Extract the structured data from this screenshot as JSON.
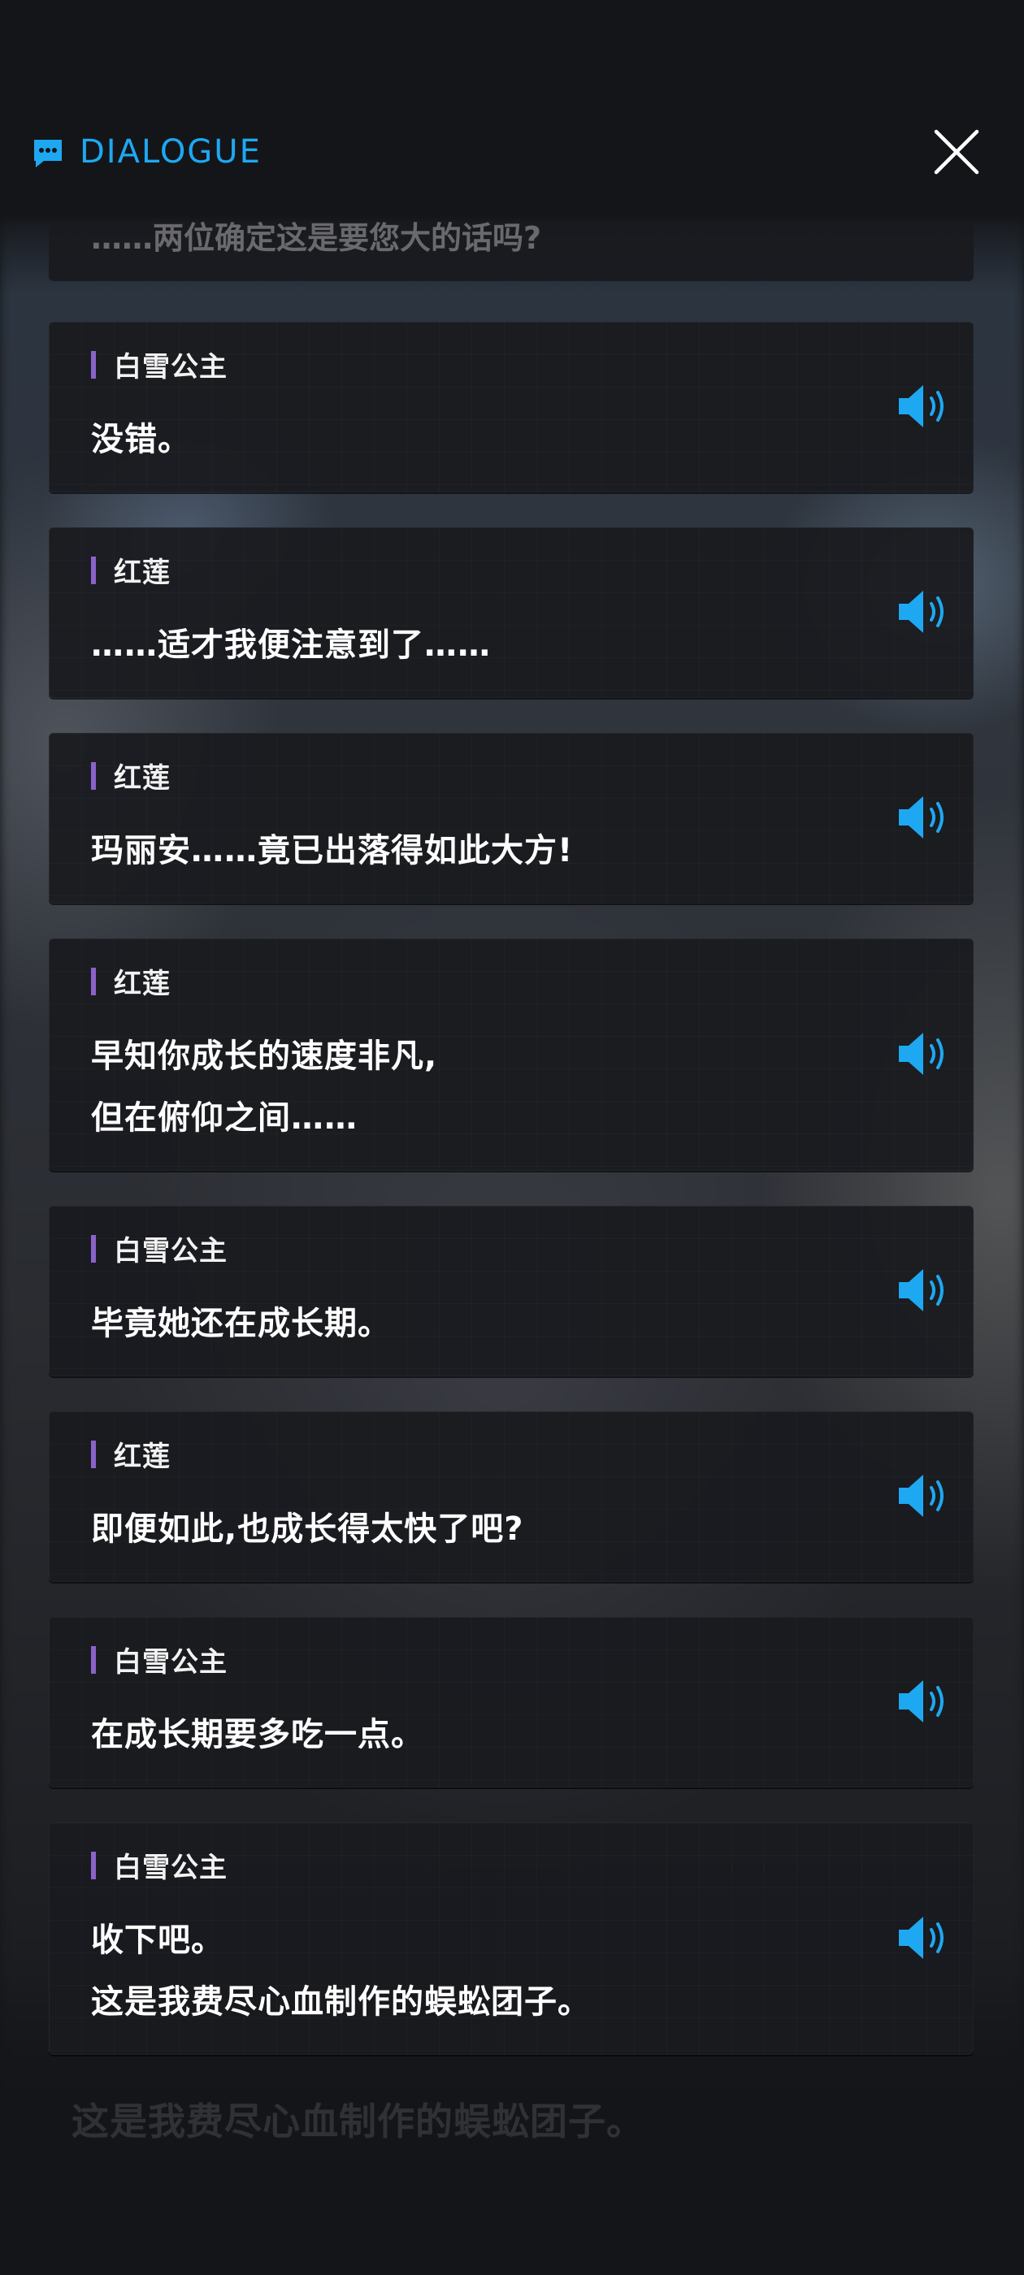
{
  "header": {
    "icon": "chat-bubble-icon",
    "title": "DIALOGUE",
    "close_icon": "close-icon",
    "accent_color": "#1ea8f2"
  },
  "dialogue": {
    "partial_line": "……两位确定这是要您大的话吗?",
    "entries": [
      {
        "speaker": "白雪公主",
        "lines": [
          "没错。"
        ]
      },
      {
        "speaker": "红莲",
        "lines": [
          "……适才我便注意到了……"
        ]
      },
      {
        "speaker": "红莲",
        "lines": [
          "玛丽安……竟已出落得如此大方!"
        ]
      },
      {
        "speaker": "红莲",
        "lines": [
          "早知你成长的速度非凡,",
          "但在俯仰之间……"
        ]
      },
      {
        "speaker": "白雪公主",
        "lines": [
          "毕竟她还在成长期。"
        ]
      },
      {
        "speaker": "红莲",
        "lines": [
          "即便如此,也成长得太快了吧?"
        ]
      },
      {
        "speaker": "白雪公主",
        "lines": [
          "在成长期要多吃一点。"
        ]
      },
      {
        "speaker": "白雪公主",
        "lines": [
          "收下吧。",
          "这是我费尽心血制作的蜈蚣团子。"
        ]
      }
    ],
    "voice_icon": "speaker-icon",
    "speaker_marker_color": "#8a63c9"
  },
  "background_caption": "这是我费尽心血制作的蜈蚣团子。"
}
